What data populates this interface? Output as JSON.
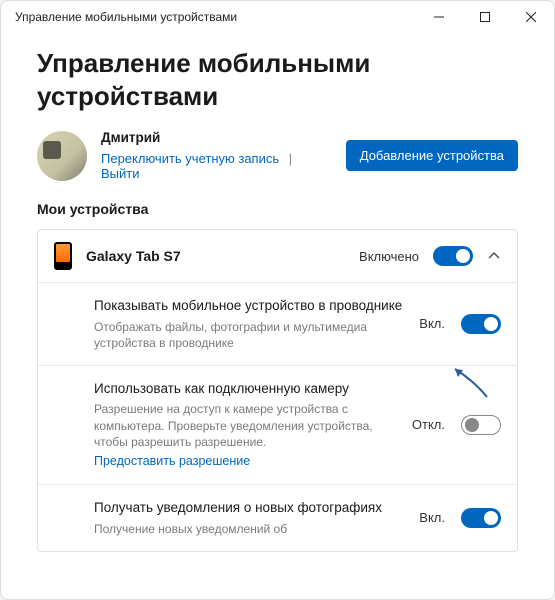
{
  "titlebar": {
    "title": "Управление мобильными устройствами"
  },
  "heading": "Управление мобильными устройствами",
  "user": {
    "name": "Дмитрий",
    "switch_link": "Переключить учетную запись",
    "signout_link": "Выйти"
  },
  "add_button": "Добавление устройства",
  "section_title": "Мои устройства",
  "device": {
    "name": "Galaxy Tab S7",
    "status": "Включено"
  },
  "settings": [
    {
      "title": "Показывать мобильное устройство в проводнике",
      "desc": "Отображать файлы, фотографии и мультимедиа устройства в проводнике",
      "status": "Вкл.",
      "on": true,
      "link": null
    },
    {
      "title": "Использовать как подключенную камеру",
      "desc": "Разрешение на доступ к камере устройства с компьютера. Проверьте уведомления устройства, чтобы разрешить разрешение.",
      "status": "Откл.",
      "on": false,
      "link": "Предоставить разрешение"
    },
    {
      "title": "Получать уведомления о новых фотографиях",
      "desc": "Получение новых уведомлений об",
      "status": "Вкл.",
      "on": true,
      "link": null
    }
  ]
}
